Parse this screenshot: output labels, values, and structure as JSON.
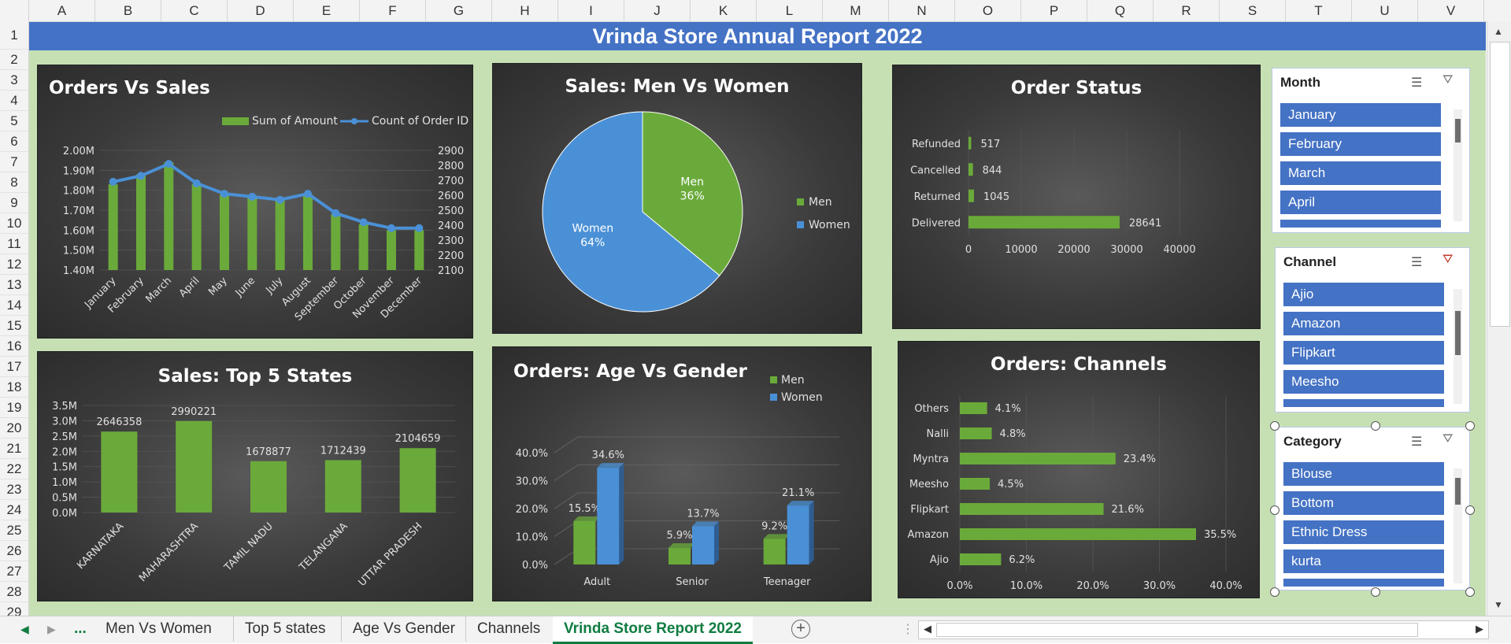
{
  "columns": [
    "A",
    "B",
    "C",
    "D",
    "E",
    "F",
    "G",
    "H",
    "I",
    "J",
    "K",
    "L",
    "M",
    "N",
    "O",
    "P",
    "Q",
    "R",
    "S",
    "T",
    "U",
    "V"
  ],
  "rows": [
    "1",
    "2",
    "3",
    "4",
    "5",
    "6",
    "7",
    "8",
    "9",
    "10",
    "11",
    "12",
    "13",
    "14",
    "15",
    "16",
    "17",
    "18",
    "19",
    "20",
    "21",
    "22",
    "23",
    "24",
    "25",
    "26",
    "27",
    "28",
    "29"
  ],
  "report_title": "Vrinda Store Annual Report 2022",
  "chart_data": [
    {
      "type": "bar",
      "title": "Orders Vs Sales",
      "categories": [
        "January",
        "February",
        "March",
        "April",
        "May",
        "June",
        "July",
        "August",
        "September",
        "October",
        "November",
        "December"
      ],
      "series": [
        {
          "name": "Sum of Amount",
          "axis": "left",
          "values": [
            1830000,
            1880000,
            1940000,
            1830000,
            1780000,
            1770000,
            1760000,
            1780000,
            1680000,
            1630000,
            1600000,
            1600000
          ]
        },
        {
          "name": "Count of Order ID",
          "axis": "right",
          "type": "line",
          "values": [
            2690,
            2730,
            2810,
            2680,
            2610,
            2590,
            2570,
            2610,
            2480,
            2420,
            2380,
            2380
          ]
        }
      ],
      "y_left_ticks": [
        "2.00M",
        "1.90M",
        "1.80M",
        "1.70M",
        "1.60M",
        "1.50M",
        "1.40M"
      ],
      "y_right_ticks": [
        "2900",
        "2800",
        "2700",
        "2600",
        "2500",
        "2400",
        "2300",
        "2200",
        "2100"
      ],
      "ylim_left": [
        1400000,
        2000000
      ],
      "ylim_right": [
        2100,
        2900
      ],
      "legend": "top-right"
    },
    {
      "type": "pie",
      "title": "Sales: Men Vs Women",
      "slices": [
        {
          "name": "Men",
          "value": 36,
          "label": "36%",
          "color": "#6aaa3a"
        },
        {
          "name": "Women",
          "value": 64,
          "label": "64%",
          "color": "#4a90d6"
        }
      ],
      "legend": "right"
    },
    {
      "type": "bar",
      "orientation": "horizontal",
      "title": "Order Status",
      "categories": [
        "Refunded",
        "Cancelled",
        "Returned",
        "Delivered"
      ],
      "values": [
        517,
        844,
        1045,
        28641
      ],
      "x_ticks": [
        "0",
        "10000",
        "20000",
        "30000",
        "40000"
      ],
      "xlim": [
        0,
        40000
      ]
    },
    {
      "type": "bar",
      "title": "Sales: Top 5 States",
      "categories": [
        "KARNATAKA",
        "MAHARASHTRA",
        "TAMIL NADU",
        "TELANGANA",
        "UTTAR PRADESH"
      ],
      "values": [
        2646358,
        2990221,
        1678877,
        1712439,
        2104659
      ],
      "y_ticks": [
        "3.5M",
        "3.0M",
        "2.5M",
        "2.0M",
        "1.5M",
        "1.0M",
        "0.5M",
        "0.0M"
      ],
      "ylim": [
        0,
        3500000
      ]
    },
    {
      "type": "bar",
      "title": "Orders: Age Vs Gender",
      "categories": [
        "Adult",
        "Senior",
        "Teenager"
      ],
      "series": [
        {
          "name": "Men",
          "values": [
            15.5,
            5.9,
            9.2
          ],
          "labels": [
            "15.5%",
            "5.9%",
            "9.2%"
          ],
          "color": "#6aaa3a"
        },
        {
          "name": "Women",
          "values": [
            34.6,
            13.7,
            21.1
          ],
          "labels": [
            "34.6%",
            "13.7%",
            "21.1%"
          ],
          "color": "#4a90d6"
        }
      ],
      "y_ticks": [
        "40.0%",
        "30.0%",
        "20.0%",
        "10.0%",
        "0.0%"
      ],
      "ylim": [
        0,
        40
      ],
      "legend": "top-right"
    },
    {
      "type": "bar",
      "orientation": "horizontal",
      "title": "Orders: Channels",
      "categories": [
        "Others",
        "Nalli",
        "Myntra",
        "Meesho",
        "Flipkart",
        "Amazon",
        "Ajio"
      ],
      "values": [
        4.1,
        4.8,
        23.4,
        4.5,
        21.6,
        35.5,
        6.2
      ],
      "labels": [
        "4.1%",
        "4.8%",
        "23.4%",
        "4.5%",
        "21.6%",
        "35.5%",
        "6.2%"
      ],
      "x_ticks": [
        "0.0%",
        "10.0%",
        "20.0%",
        "30.0%",
        "40.0%"
      ],
      "xlim": [
        0,
        40
      ]
    }
  ],
  "slicers": {
    "month": {
      "title": "Month",
      "items": [
        "January",
        "February",
        "March",
        "April"
      ],
      "thumb_pos": 0.0
    },
    "channel": {
      "title": "Channel",
      "items": [
        "Ajio",
        "Amazon",
        "Flipkart",
        "Meesho"
      ],
      "thumb_pos": 0.2
    },
    "category": {
      "title": "Category",
      "items": [
        "Blouse",
        "Bottom",
        "Ethnic Dress",
        "kurta"
      ],
      "thumb_pos": 0.0
    }
  },
  "tabs": {
    "more": "...",
    "list": [
      "Men Vs Women",
      "Top 5 states",
      "Age Vs Gender",
      "Channels",
      "Vrinda Store Report 2022"
    ],
    "active": "Vrinda Store Report 2022"
  },
  "colors": {
    "green": "#6aaa3a",
    "blue": "#4a90d6",
    "title_bar": "#4472c4",
    "sheet_bg": "#c6e0b4"
  }
}
